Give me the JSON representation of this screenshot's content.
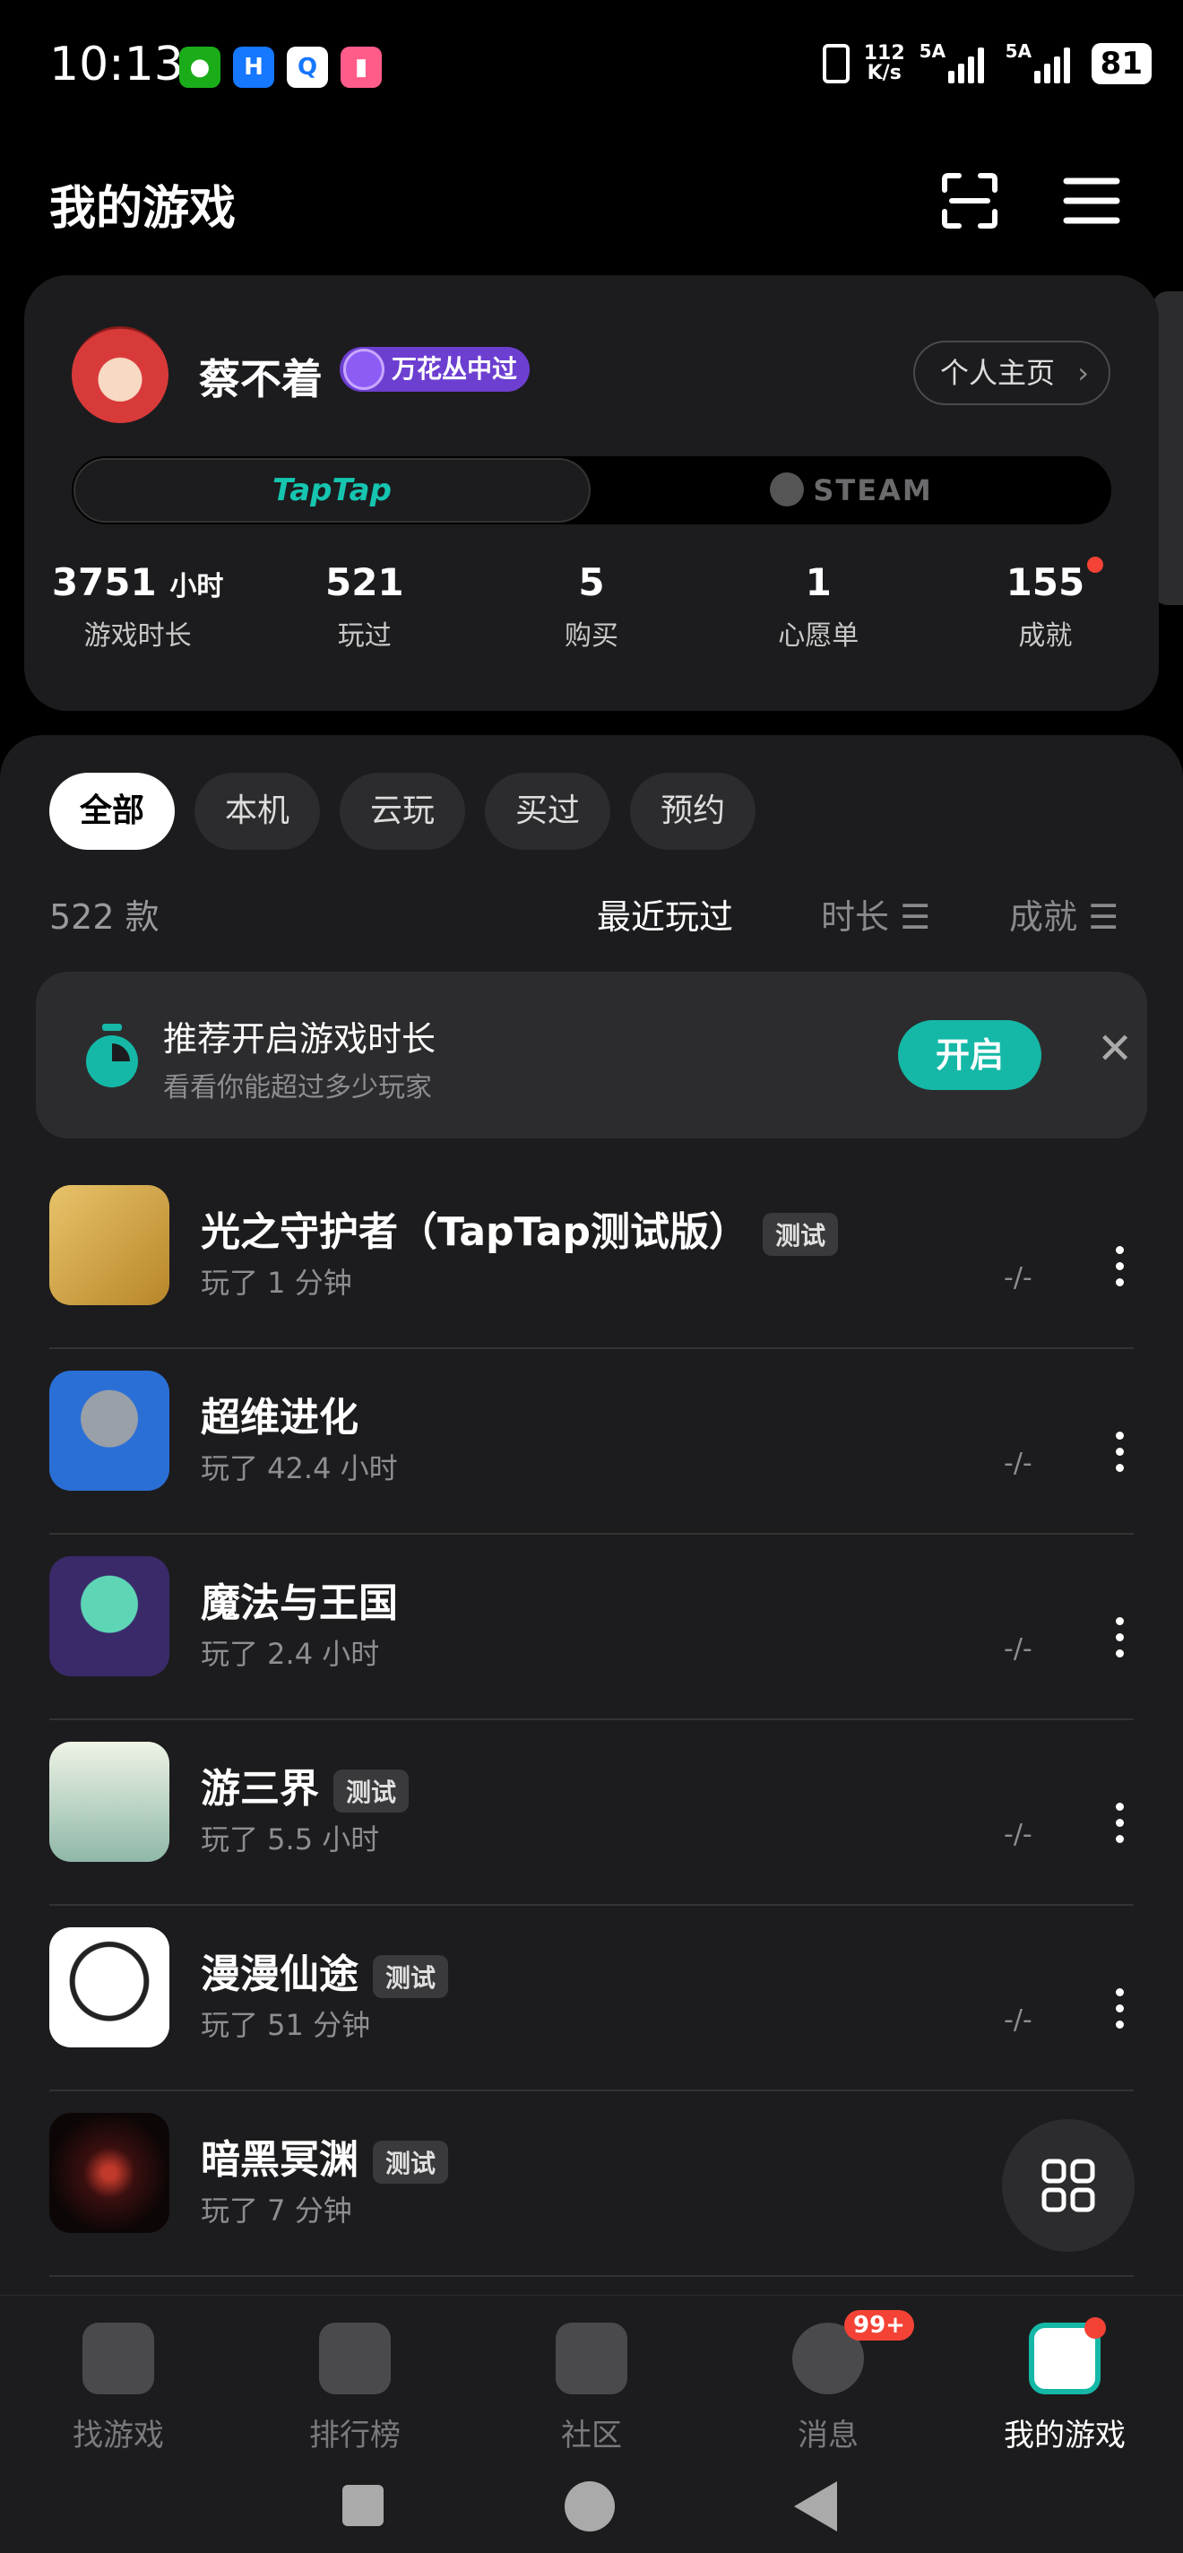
{
  "status_bar": {
    "time": "10:13",
    "net_speed_top": "112",
    "net_speed_bottom": "K/s",
    "sim1": "5A",
    "sim2": "5A",
    "battery": "81"
  },
  "header": {
    "title": "我的游戏"
  },
  "profile": {
    "username": "蔡不着",
    "badge": "万花丛中过",
    "profile_button": "个人主页",
    "platforms": [
      "TapTap",
      "STEAM"
    ],
    "stats": [
      {
        "value": "3751",
        "unit": "小时",
        "label": "游戏时长"
      },
      {
        "value": "521",
        "unit": "",
        "label": "玩过"
      },
      {
        "value": "5",
        "unit": "",
        "label": "购买"
      },
      {
        "value": "1",
        "unit": "",
        "label": "心愿单"
      },
      {
        "value": "155",
        "unit": "",
        "label": "成就"
      }
    ]
  },
  "filters": [
    "全部",
    "本机",
    "云玩",
    "买过",
    "预约"
  ],
  "list": {
    "count": "522 款",
    "sort_recent": "最近玩过",
    "sort_duration": "时长 ☰",
    "sort_achievement": "成就 ☰"
  },
  "recommend": {
    "title": "推荐开启游戏时长",
    "subtitle": "看看你能超过多少玩家",
    "button": "开启"
  },
  "games": [
    {
      "name": "光之守护者（TapTap测试版）",
      "tag": "测试",
      "played": "玩了 1 分钟",
      "score": "-/-"
    },
    {
      "name": "超维进化",
      "tag": "",
      "played": "玩了 42.4 小时",
      "score": "-/-"
    },
    {
      "name": "魔法与王国",
      "tag": "",
      "played": "玩了 2.4 小时",
      "score": "-/-"
    },
    {
      "name": "游三界",
      "tag": "测试",
      "played": "玩了 5.5 小时",
      "score": "-/-"
    },
    {
      "name": "漫漫仙途",
      "tag": "测试",
      "played": "玩了 51 分钟",
      "score": "-/-"
    },
    {
      "name": "暗黑冥渊",
      "tag": "测试",
      "played": "玩了 7 分钟",
      "score": ""
    }
  ],
  "nav": [
    {
      "label": "找游戏",
      "icon": "hammer-icon"
    },
    {
      "label": "排行榜",
      "icon": "podium-icon"
    },
    {
      "label": "社区",
      "icon": "community-icon"
    },
    {
      "label": "消息",
      "icon": "message-icon",
      "badge": "99+"
    },
    {
      "label": "我的游戏",
      "icon": "my-games-icon"
    }
  ],
  "colors": {
    "accent": "#15b8a6",
    "card": "#1c1c1e",
    "badge": "#6d3fd1",
    "alert": "#f44336"
  }
}
